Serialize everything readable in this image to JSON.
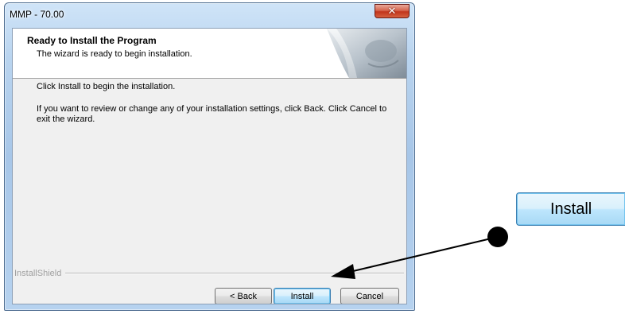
{
  "window": {
    "title": "MMP - 70.00",
    "close_glyph": "✕"
  },
  "header": {
    "title": "Ready to Install the Program",
    "subtitle": "The wizard is ready to begin installation."
  },
  "body": {
    "line1": "Click Install to begin the installation.",
    "line2": "If you want to review or change any of your installation settings, click Back. Click Cancel to exit the wizard."
  },
  "footer": {
    "brand": "InstallShield"
  },
  "buttons": {
    "back": "< Back",
    "install": "Install",
    "cancel": "Cancel"
  },
  "callout": {
    "label": "Install"
  },
  "icons": [
    "close-icon",
    "wizard-header-graphic",
    "callout-dot-icon",
    "callout-arrow-icon"
  ],
  "colors": {
    "accent": "#3c7fb1",
    "close": "#c2351c",
    "callout": "#000000"
  }
}
